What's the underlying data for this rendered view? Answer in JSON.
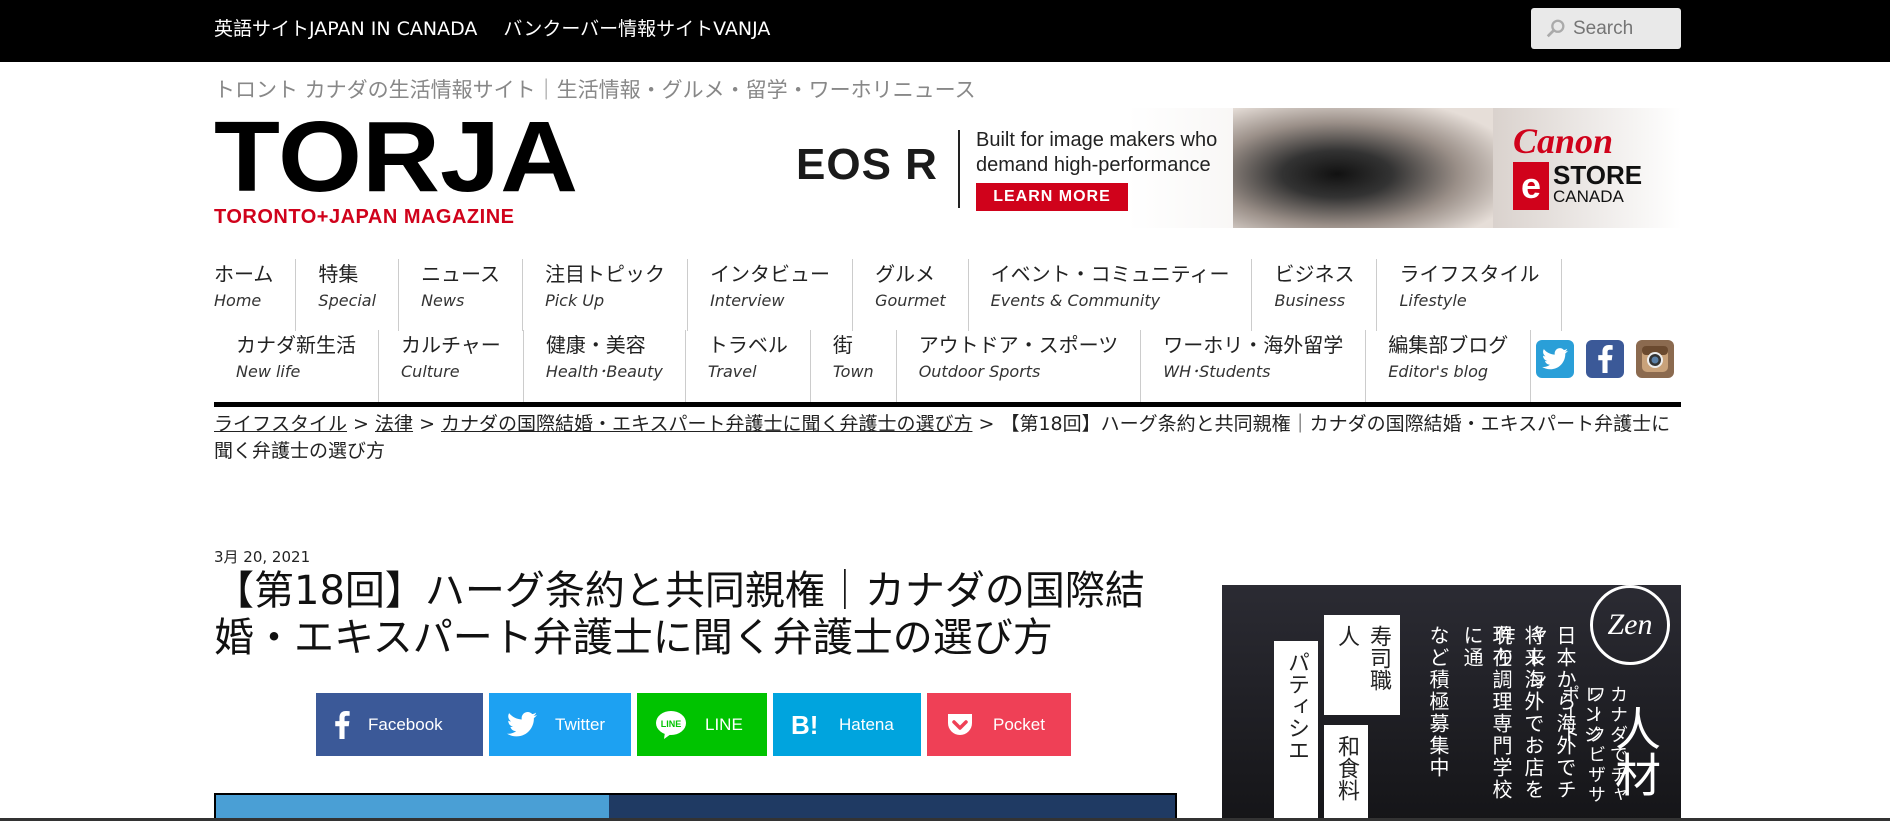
{
  "topbar": {
    "links": [
      "英語サイトJAPAN IN CANADA",
      "バンクーバー情報サイトVANJA"
    ],
    "search_placeholder": "Search"
  },
  "site": {
    "tagline": "トロント カナダの生活情報サイト｜生活情報・グルメ・留学・ワーホリニュース",
    "logo_main": "TORJA",
    "logo_sub": "TORONTO+JAPAN MAGAZINE"
  },
  "ad": {
    "brand": "EOS R",
    "text_line1": "Built for image makers who",
    "text_line2": "demand high-performance",
    "button": "LEARN MORE",
    "canon": "Canon",
    "store_e": "e",
    "store_line1": "STORE",
    "store_line2": "CANADA"
  },
  "nav": {
    "row1": [
      {
        "jp": "ホーム",
        "en": "Home"
      },
      {
        "jp": "特集",
        "en": "Special"
      },
      {
        "jp": "ニュース",
        "en": "News"
      },
      {
        "jp": "注目トピック",
        "en": "Pick Up"
      },
      {
        "jp": "インタビュー",
        "en": "Interview"
      },
      {
        "jp": "グルメ",
        "en": "Gourmet"
      },
      {
        "jp": "イベント・コミュニティー",
        "en": "Events & Community"
      },
      {
        "jp": "ビジネス",
        "en": "Business"
      },
      {
        "jp": "ライフスタイル",
        "en": "Lifestyle"
      }
    ],
    "row2": [
      {
        "jp": "カナダ新生活",
        "en": "New life"
      },
      {
        "jp": "カルチャー",
        "en": "Culture"
      },
      {
        "jp": "健康・美容",
        "en": "Health･Beauty"
      },
      {
        "jp": "トラベル",
        "en": "Travel"
      },
      {
        "jp": "街",
        "en": "Town"
      },
      {
        "jp": "アウトドア・スポーツ",
        "en": "Outdoor Sports"
      },
      {
        "jp": "ワーホリ・海外留学",
        "en": "WH･Students"
      },
      {
        "jp": "編集部ブログ",
        "en": "Editor's blog"
      }
    ]
  },
  "breadcrumb": {
    "items": [
      "ライフスタイル",
      "法律",
      "カナダの国際結婚・エキスパート弁護士に聞く弁護士の選び方"
    ],
    "separator": " > ",
    "current": "【第18回】ハーグ条約と共同親権｜カナダの国際結婚・エキスパート弁護士に聞く弁護士の選び方"
  },
  "post": {
    "date": "3月 20, 2021",
    "title": "【第18回】ハーグ条約と共同親権｜カナダの国際結婚・エキスパート弁護士に聞く弁護士の選び方"
  },
  "share": {
    "facebook": "Facebook",
    "twitter": "Twitter",
    "line": "LINE",
    "hatena": "Hatena",
    "pocket": "Pocket"
  },
  "side_ad": {
    "logo": "Zen",
    "heading": "人材",
    "col1": "カナダでチャレンジ",
    "col2": "ワークビザサポート",
    "check1": "日本から海外でチャレン",
    "check2": "将来海外でお店を作り",
    "check3": "現在調理専門学校に通",
    "col_last": "など積極募集中",
    "card1": "寿司職人",
    "card2": "パティシエ",
    "card3": "和食料"
  },
  "colors": {
    "topbar": "#000000",
    "brand_red": "#d0021b",
    "facebook": "#3b5998",
    "twitter": "#1da1f2",
    "line": "#00c300",
    "hatena": "#00a4de",
    "pocket": "#ef4056"
  }
}
